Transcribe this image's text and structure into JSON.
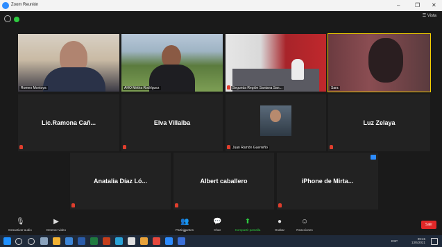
{
  "window": {
    "title": "Zoom Reunión",
    "minimize": "–",
    "maximize": "❐",
    "close": "✕"
  },
  "topbar": {
    "view_label": "☰ Vista"
  },
  "video_tiles": [
    {
      "label": "Romeo Montoya"
    },
    {
      "label": "AHO Mirtha Rodríguez"
    },
    {
      "label": "Segunda Región Santana San..."
    },
    {
      "label": "Sara"
    }
  ],
  "name_tiles_row2": [
    {
      "name": "Lic.Ramona  Cañ..."
    },
    {
      "name": "Elva Villalba"
    },
    {
      "label": "Juan Ramón Guerreño"
    },
    {
      "name": "Luz Zelaya"
    }
  ],
  "name_tiles_row3": [
    {
      "name": "Anatalia  Díaz  Ló..."
    },
    {
      "name": "Albert caballero"
    },
    {
      "name": "iPhone de Mirta..."
    }
  ],
  "toolbar": {
    "mute": "Desactivar audio",
    "video": "Detener video",
    "participants": "Participantes",
    "participants_count": "11",
    "chat": "Chat",
    "share": "Compartir pantalla",
    "record": "Grabar",
    "reactions": "Reacciones",
    "leave": "Salir"
  },
  "taskbar": {
    "lang": "ESP",
    "time": "09:45",
    "date": "13/5/2021"
  },
  "colors": {
    "accent": "#2d8cff",
    "active_speaker": "#f4d000",
    "share_green": "#2ecc40",
    "leave_red": "#e02828"
  }
}
